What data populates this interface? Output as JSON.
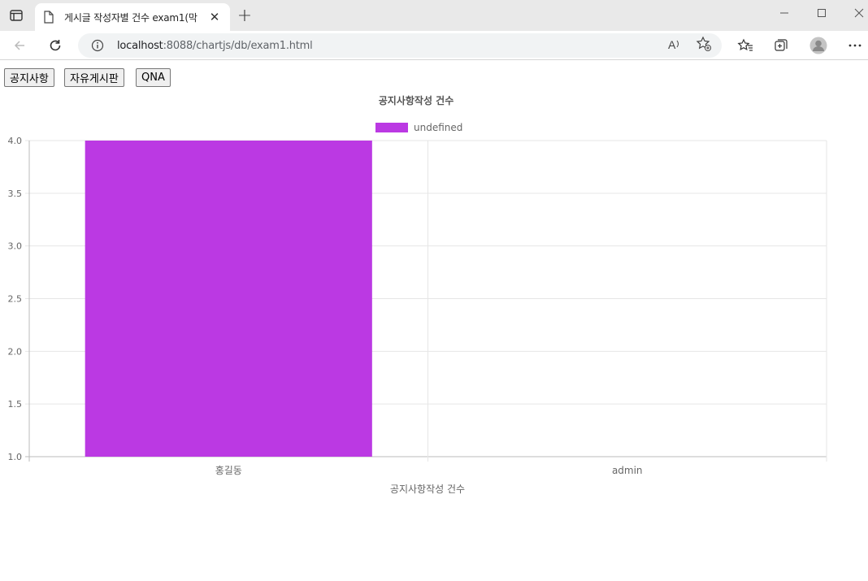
{
  "browser": {
    "tab_title": "게시글 작성자별 건수 exam1(막",
    "url_host": "localhost",
    "url_path": ":8088/chartjs/db/exam1.html"
  },
  "page": {
    "buttons": [
      {
        "label": "공지사항"
      },
      {
        "label": "자유게시판"
      },
      {
        "label": "QNA"
      }
    ]
  },
  "chart_data": {
    "type": "bar",
    "title": "공지사항작성 건수",
    "xlabel": "공지사항작성 건수",
    "ylabel": "",
    "categories": [
      "홍길동",
      "admin"
    ],
    "series": [
      {
        "name": "undefined",
        "values": [
          4,
          1
        ],
        "color": "#bb39e3"
      }
    ],
    "ylim": [
      1,
      4
    ],
    "yticks": [
      "4.0",
      "3.5",
      "3.0",
      "2.5",
      "2.0",
      "1.5",
      "1.0"
    ],
    "grid": true,
    "legend_position": "top"
  }
}
